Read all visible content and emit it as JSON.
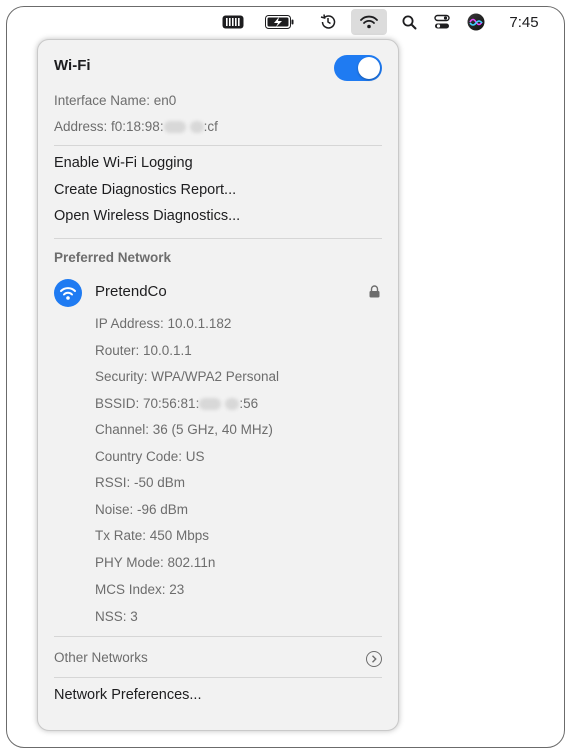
{
  "menubar": {
    "icons": [
      "memory-icon",
      "battery-charging-icon",
      "time-machine-icon",
      "wifi-icon",
      "search-icon",
      "control-center-icon",
      "siri-icon"
    ],
    "clock": "7:45"
  },
  "wifi": {
    "title": "Wi-Fi",
    "toggle_on": true,
    "interface_name": "Interface Name: en0",
    "address_prefix": "Address: f0:18:98:",
    "address_suffix": ":cf"
  },
  "actions": [
    {
      "label": "Enable Wi-Fi Logging"
    },
    {
      "label": "Create Diagnostics Report..."
    },
    {
      "label": "Open Wireless Diagnostics..."
    }
  ],
  "preferred": {
    "header": "Preferred Network",
    "network_name": "PretendCo",
    "ip": "IP Address: 10.0.1.182",
    "router": "Router: 10.0.1.1",
    "security": "Security: WPA/WPA2 Personal",
    "bssid_prefix": "BSSID: 70:56:81:",
    "bssid_suffix": ":56",
    "channel": "Channel: 36 (5 GHz, 40 MHz)",
    "country": "Country Code: US",
    "rssi": "RSSI: -50 dBm",
    "noise": "Noise: -96 dBm",
    "tx_rate": "Tx Rate: 450 Mbps",
    "phy_mode": "PHY Mode: 802.11n",
    "mcs_index": "MCS Index: 23",
    "nss": "NSS: 3"
  },
  "other_networks": "Other Networks",
  "network_preferences": "Network Preferences...",
  "colors": {
    "accent": "#1f7bf2",
    "panel": "#f2f2f2"
  }
}
